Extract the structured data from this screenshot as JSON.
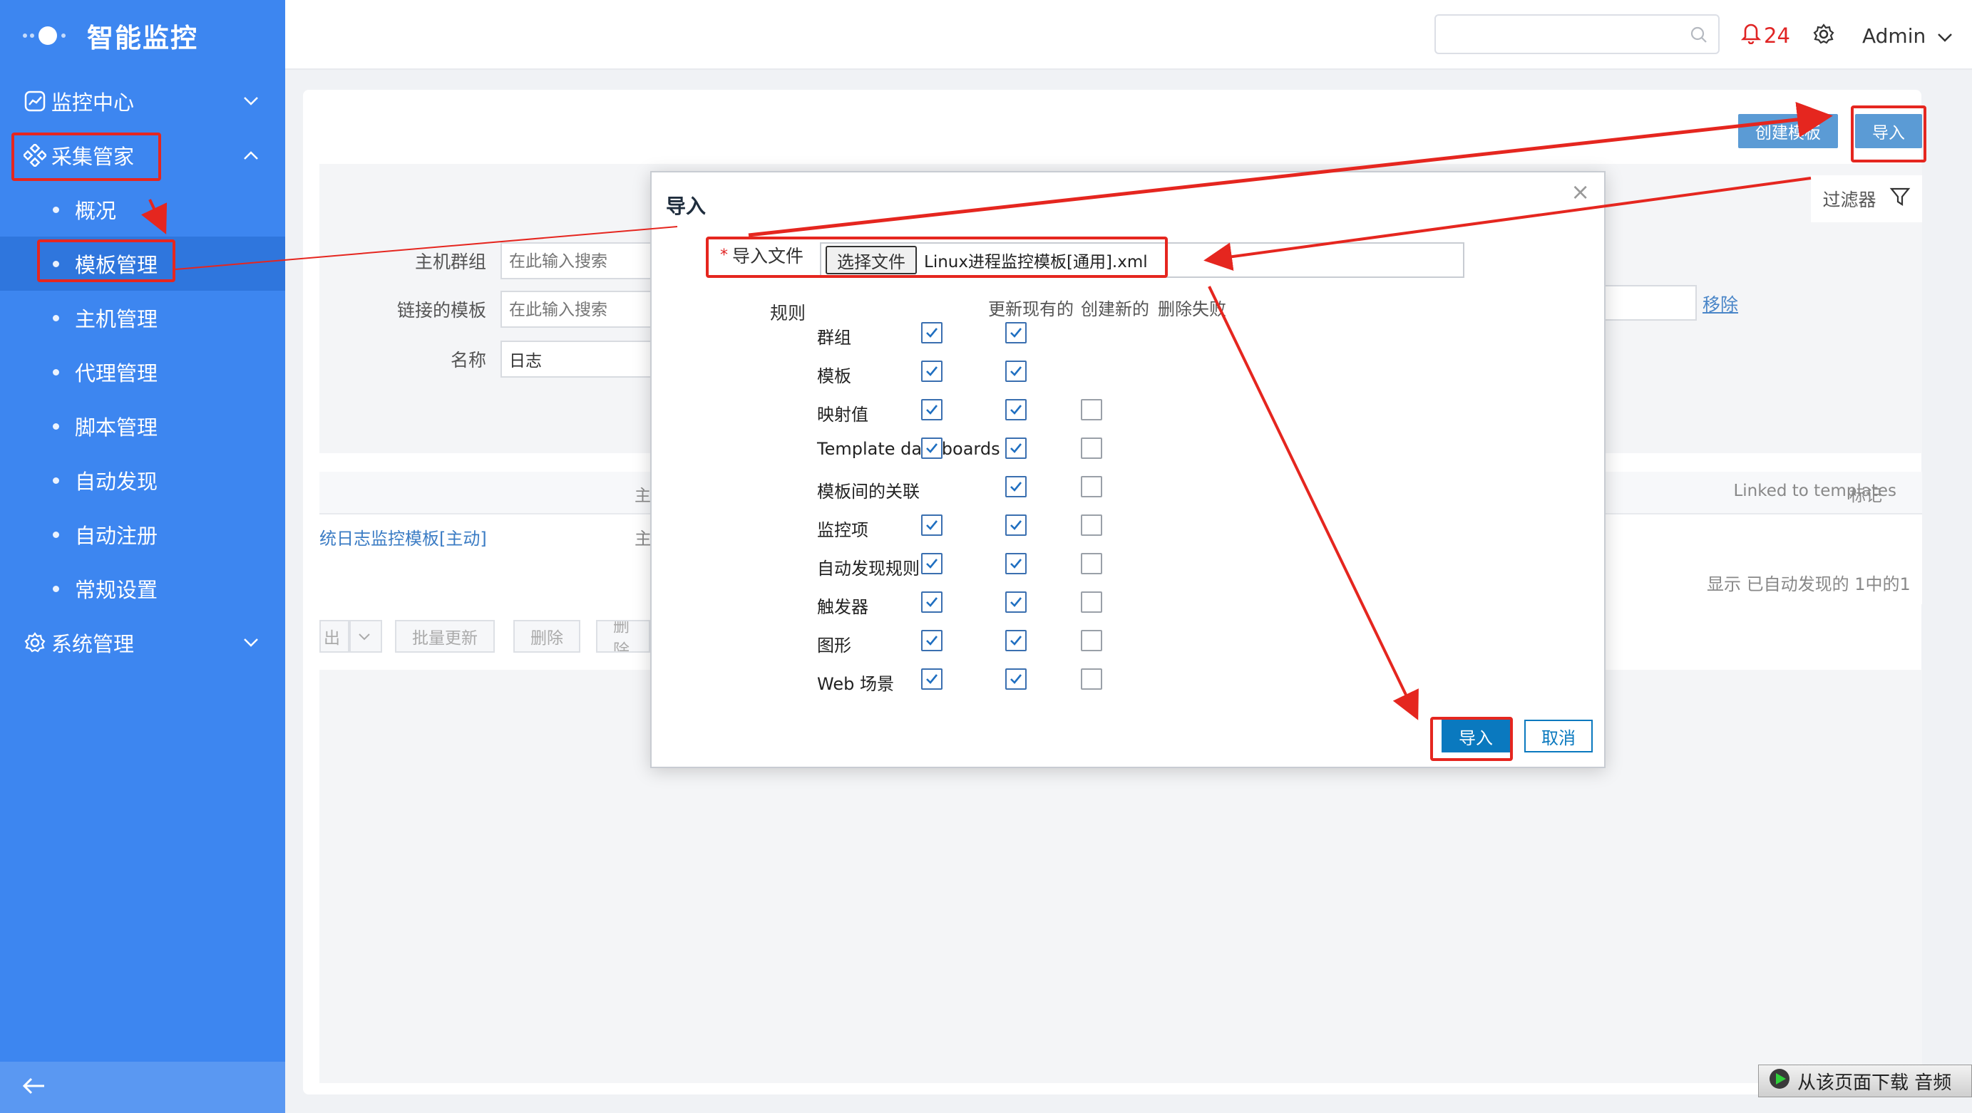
{
  "brand": {
    "title": "智能监控"
  },
  "sidebar": {
    "groups": [
      {
        "label": "监控中心",
        "expanded": false
      },
      {
        "label": "采集管家",
        "expanded": true
      },
      {
        "label": "系统管理",
        "expanded": false
      }
    ],
    "sub_items": [
      {
        "label": "概况"
      },
      {
        "label": "模板管理",
        "active": true
      },
      {
        "label": "主机管理"
      },
      {
        "label": "代理管理"
      },
      {
        "label": "脚本管理"
      },
      {
        "label": "自动发现"
      },
      {
        "label": "自动注册"
      },
      {
        "label": "常规设置"
      }
    ]
  },
  "header": {
    "search_placeholder": "",
    "alert_count": "24",
    "user": "Admin"
  },
  "toolbar": {
    "create_label": "创建模板",
    "import_label": "导入"
  },
  "filter": {
    "tab_label": "过滤器",
    "host_group_label": "主机群组",
    "host_group_placeholder": "在此输入搜索",
    "linked_label": "链接的模板",
    "linked_placeholder": "在此输入搜索",
    "name_label": "名称",
    "name_value": "日志",
    "remove_label": "移除"
  },
  "table": {
    "col_host": "主",
    "col_linked": "Linked to templates",
    "col_tags": "标记",
    "row_name": "统日志监控模板[主动]",
    "row_host": "主",
    "pager": "显示 已自动发现的 1中的1"
  },
  "bulk": {
    "export": "出",
    "mass_update": "批量更新",
    "delete": "删除",
    "delete_clear": "删除"
  },
  "modal": {
    "title": "导入",
    "file_label": "导入文件",
    "choose_file": "选择文件",
    "file_name": "Linux进程监控模板[通用].xml",
    "rules_label": "规则",
    "col_update": "更新现有的",
    "col_create": "创建新的",
    "col_delete": "删除失败",
    "rules": [
      {
        "name": "群组",
        "update": true,
        "create": true,
        "delete": null
      },
      {
        "name": "模板",
        "update": true,
        "create": true,
        "delete": null
      },
      {
        "name": "映射值",
        "update": true,
        "create": true,
        "delete": false
      },
      {
        "name": "Template dashboards",
        "update": true,
        "create": true,
        "delete": false
      },
      {
        "name": "模板间的关联",
        "update": null,
        "create": true,
        "delete": false
      },
      {
        "name": "监控项",
        "update": true,
        "create": true,
        "delete": false
      },
      {
        "name": "自动发现规则",
        "update": true,
        "create": true,
        "delete": false
      },
      {
        "name": "触发器",
        "update": true,
        "create": true,
        "delete": false
      },
      {
        "name": "图形",
        "update": true,
        "create": true,
        "delete": false
      },
      {
        "name": "Web 场景",
        "update": true,
        "create": true,
        "delete": false
      }
    ],
    "import_button": "导入",
    "cancel_button": "取消"
  },
  "watermark": {
    "text": "从该页面下载 音频"
  },
  "colors": {
    "sidebar": "#3d86f0",
    "annotation": "#e5261f",
    "primary": "#0a79bf"
  }
}
